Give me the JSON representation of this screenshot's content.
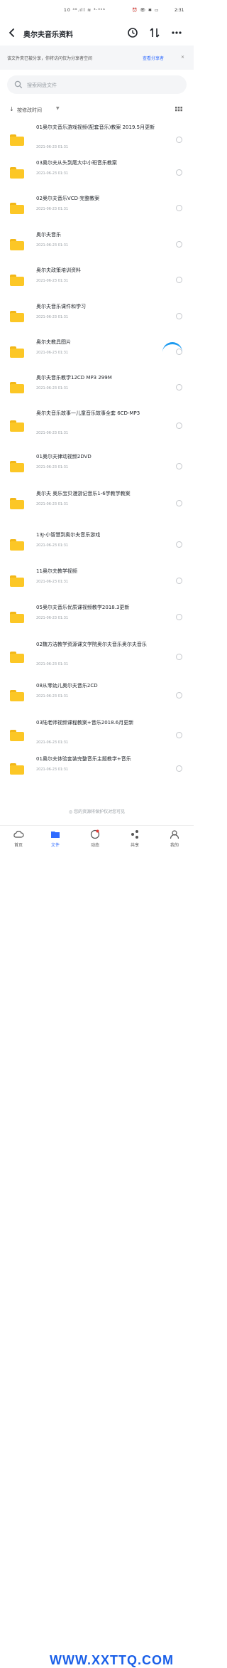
{
  "status_bar": {
    "left": "10 ⁴⁶.ıll ≋ ³·⁰ᵏᵇ",
    "right": "⏰ 👁 ✱ ▭",
    "time": "2:31"
  },
  "header": {
    "title": "奥尔夫音乐资料",
    "icons": [
      "back-icon",
      "clock-icon",
      "sort-icon",
      "more-icon"
    ]
  },
  "notice": {
    "text": "该文件夹已被分享，你将访问仅为分享者空间",
    "link": "查看分享者",
    "close": "✕"
  },
  "search": {
    "placeholder": "搜索网盘文件"
  },
  "sort": {
    "label": "按修改时间",
    "caret": "▼"
  },
  "files": [
    {
      "name": "01奥尔夫音乐游戏视频(配套音乐)教案 2019.5月更新",
      "date": "2021-06-23  01:31"
    },
    {
      "name": "03奥尔夫从头到尾大中小班音乐教案",
      "date": "2021-06-23  01:31"
    },
    {
      "name": "02奥尔夫音乐VCD·完整教案",
      "date": "2021-06-23  01:31"
    },
    {
      "name": "奥尔夫音乐",
      "date": "2021-06-23  01:31"
    },
    {
      "name": "奥尔夫政策培训资料",
      "date": "2021-06-23  01:31"
    },
    {
      "name": "奥尔夫音乐课件和学习",
      "date": "2021-06-23  01:31"
    },
    {
      "name": "奥尔夫教具图片",
      "date": "2021-06-23  01:31"
    },
    {
      "name": "奥尔夫音乐教学12CD MP3  299M",
      "date": "2021-06-23  01:31"
    },
    {
      "name": "奥尔夫音乐故事一儿童音乐故事全套 6CD-MP3",
      "date": "2021-06-23  01:31"
    },
    {
      "name": "01奥尔夫律动视频2DVD",
      "date": "2021-06-23  01:31"
    },
    {
      "name": "奥尔夫 奥乐宝贝漫游记音乐1-6学教学教案",
      "date": "2021-06-23  01:31"
    },
    {
      "name": "13J-小智慧到奥尔夫音乐游戏",
      "date": "2021-06-23  01:31"
    },
    {
      "name": "11奥尔夫教学视频",
      "date": "2021-06-23  01:31"
    },
    {
      "name": "05奥尔夫音乐优质课视频教学2018.3更新",
      "date": "2021-06-23  01:31"
    },
    {
      "name": "02魏方洁教学资源课文学院奥尔夫音乐奥尔夫音乐",
      "date": "2021-06-23  01:31"
    },
    {
      "name": "08从零幼儿奥尔夫音乐2CD",
      "date": "2021-06-23  01:31"
    },
    {
      "name": "03陆老师视频课程教案+音乐2018.6月更新",
      "date": "2021-06-23  01:31"
    },
    {
      "name": "01奥尔夫体验套装完整音乐主题教学+音乐",
      "date": "2021-06-23  01:31"
    }
  ],
  "footer_note": "◎ 您的资源将保护仅对您可见",
  "tabbar": {
    "items": [
      "首页",
      "文件",
      "动态",
      "共享",
      "我的"
    ]
  },
  "watermark": "WWW.XXTTQ.COM",
  "colors": {
    "accent": "#2f6bff",
    "folder": "#fcc726",
    "float_button": "#1e9bf0"
  }
}
